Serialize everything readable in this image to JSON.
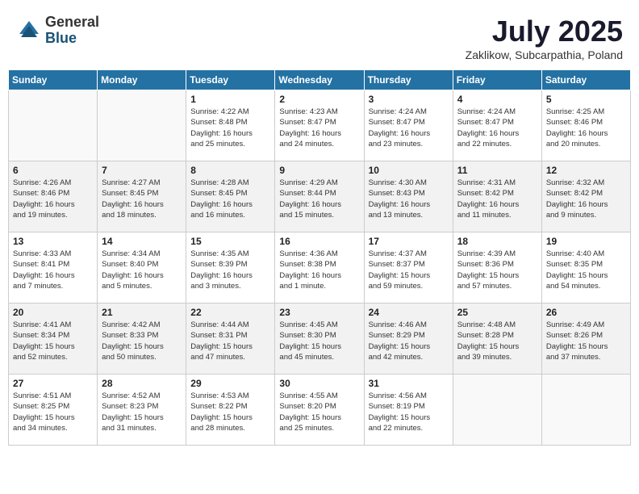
{
  "header": {
    "logo_general": "General",
    "logo_blue": "Blue",
    "month_title": "July 2025",
    "subtitle": "Zaklikow, Subcarpathia, Poland"
  },
  "weekdays": [
    "Sunday",
    "Monday",
    "Tuesday",
    "Wednesday",
    "Thursday",
    "Friday",
    "Saturday"
  ],
  "weeks": [
    [
      {
        "day": "",
        "info": ""
      },
      {
        "day": "",
        "info": ""
      },
      {
        "day": "1",
        "info": "Sunrise: 4:22 AM\nSunset: 8:48 PM\nDaylight: 16 hours\nand 25 minutes."
      },
      {
        "day": "2",
        "info": "Sunrise: 4:23 AM\nSunset: 8:47 PM\nDaylight: 16 hours\nand 24 minutes."
      },
      {
        "day": "3",
        "info": "Sunrise: 4:24 AM\nSunset: 8:47 PM\nDaylight: 16 hours\nand 23 minutes."
      },
      {
        "day": "4",
        "info": "Sunrise: 4:24 AM\nSunset: 8:47 PM\nDaylight: 16 hours\nand 22 minutes."
      },
      {
        "day": "5",
        "info": "Sunrise: 4:25 AM\nSunset: 8:46 PM\nDaylight: 16 hours\nand 20 minutes."
      }
    ],
    [
      {
        "day": "6",
        "info": "Sunrise: 4:26 AM\nSunset: 8:46 PM\nDaylight: 16 hours\nand 19 minutes."
      },
      {
        "day": "7",
        "info": "Sunrise: 4:27 AM\nSunset: 8:45 PM\nDaylight: 16 hours\nand 18 minutes."
      },
      {
        "day": "8",
        "info": "Sunrise: 4:28 AM\nSunset: 8:45 PM\nDaylight: 16 hours\nand 16 minutes."
      },
      {
        "day": "9",
        "info": "Sunrise: 4:29 AM\nSunset: 8:44 PM\nDaylight: 16 hours\nand 15 minutes."
      },
      {
        "day": "10",
        "info": "Sunrise: 4:30 AM\nSunset: 8:43 PM\nDaylight: 16 hours\nand 13 minutes."
      },
      {
        "day": "11",
        "info": "Sunrise: 4:31 AM\nSunset: 8:42 PM\nDaylight: 16 hours\nand 11 minutes."
      },
      {
        "day": "12",
        "info": "Sunrise: 4:32 AM\nSunset: 8:42 PM\nDaylight: 16 hours\nand 9 minutes."
      }
    ],
    [
      {
        "day": "13",
        "info": "Sunrise: 4:33 AM\nSunset: 8:41 PM\nDaylight: 16 hours\nand 7 minutes."
      },
      {
        "day": "14",
        "info": "Sunrise: 4:34 AM\nSunset: 8:40 PM\nDaylight: 16 hours\nand 5 minutes."
      },
      {
        "day": "15",
        "info": "Sunrise: 4:35 AM\nSunset: 8:39 PM\nDaylight: 16 hours\nand 3 minutes."
      },
      {
        "day": "16",
        "info": "Sunrise: 4:36 AM\nSunset: 8:38 PM\nDaylight: 16 hours\nand 1 minute."
      },
      {
        "day": "17",
        "info": "Sunrise: 4:37 AM\nSunset: 8:37 PM\nDaylight: 15 hours\nand 59 minutes."
      },
      {
        "day": "18",
        "info": "Sunrise: 4:39 AM\nSunset: 8:36 PM\nDaylight: 15 hours\nand 57 minutes."
      },
      {
        "day": "19",
        "info": "Sunrise: 4:40 AM\nSunset: 8:35 PM\nDaylight: 15 hours\nand 54 minutes."
      }
    ],
    [
      {
        "day": "20",
        "info": "Sunrise: 4:41 AM\nSunset: 8:34 PM\nDaylight: 15 hours\nand 52 minutes."
      },
      {
        "day": "21",
        "info": "Sunrise: 4:42 AM\nSunset: 8:33 PM\nDaylight: 15 hours\nand 50 minutes."
      },
      {
        "day": "22",
        "info": "Sunrise: 4:44 AM\nSunset: 8:31 PM\nDaylight: 15 hours\nand 47 minutes."
      },
      {
        "day": "23",
        "info": "Sunrise: 4:45 AM\nSunset: 8:30 PM\nDaylight: 15 hours\nand 45 minutes."
      },
      {
        "day": "24",
        "info": "Sunrise: 4:46 AM\nSunset: 8:29 PM\nDaylight: 15 hours\nand 42 minutes."
      },
      {
        "day": "25",
        "info": "Sunrise: 4:48 AM\nSunset: 8:28 PM\nDaylight: 15 hours\nand 39 minutes."
      },
      {
        "day": "26",
        "info": "Sunrise: 4:49 AM\nSunset: 8:26 PM\nDaylight: 15 hours\nand 37 minutes."
      }
    ],
    [
      {
        "day": "27",
        "info": "Sunrise: 4:51 AM\nSunset: 8:25 PM\nDaylight: 15 hours\nand 34 minutes."
      },
      {
        "day": "28",
        "info": "Sunrise: 4:52 AM\nSunset: 8:23 PM\nDaylight: 15 hours\nand 31 minutes."
      },
      {
        "day": "29",
        "info": "Sunrise: 4:53 AM\nSunset: 8:22 PM\nDaylight: 15 hours\nand 28 minutes."
      },
      {
        "day": "30",
        "info": "Sunrise: 4:55 AM\nSunset: 8:20 PM\nDaylight: 15 hours\nand 25 minutes."
      },
      {
        "day": "31",
        "info": "Sunrise: 4:56 AM\nSunset: 8:19 PM\nDaylight: 15 hours\nand 22 minutes."
      },
      {
        "day": "",
        "info": ""
      },
      {
        "day": "",
        "info": ""
      }
    ]
  ]
}
